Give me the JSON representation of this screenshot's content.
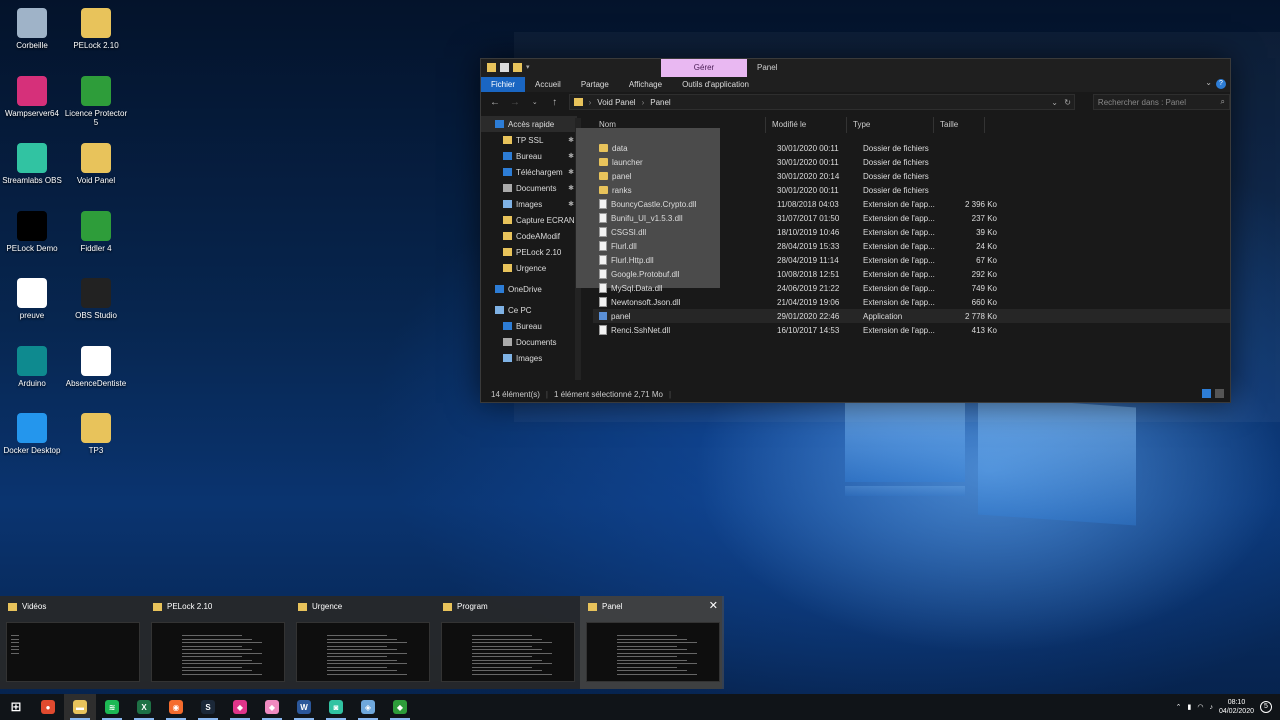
{
  "desktop_icons": [
    {
      "label": "Corbeille",
      "icon": "recycle-bin-icon",
      "color": "#9fb3c8"
    },
    {
      "label": "PELock 2.10",
      "icon": "folder-icon",
      "color": "#e8c35b"
    },
    {
      "label": "Wampserver64",
      "icon": "wamp-icon",
      "color": "#d6307a"
    },
    {
      "label": "Licence Protector 5",
      "icon": "shield-icon",
      "color": "#2e9d3a"
    },
    {
      "label": "Streamlabs OBS",
      "icon": "streamlabs-icon",
      "color": "#31c3a2"
    },
    {
      "label": "Void Panel",
      "icon": "folder-icon",
      "color": "#e8c35b"
    },
    {
      "label": "PELock Demo",
      "icon": "pe-icon",
      "color": "#000000"
    },
    {
      "label": "Fiddler 4",
      "icon": "fiddler-icon",
      "color": "#2e9d3a"
    },
    {
      "label": "preuve",
      "icon": "document-icon",
      "color": "#ffffff"
    },
    {
      "label": "OBS Studio",
      "icon": "obs-icon",
      "color": "#222222"
    },
    {
      "label": "Arduino",
      "icon": "arduino-icon",
      "color": "#0e8a8f"
    },
    {
      "label": "AbsenceDentiste",
      "icon": "document-icon",
      "color": "#ffffff"
    },
    {
      "label": "Docker Desktop",
      "icon": "docker-icon",
      "color": "#2496ed"
    },
    {
      "label": "TP3",
      "icon": "zip-icon",
      "color": "#e8c35b"
    }
  ],
  "explorer": {
    "manage_tab": "Gérer",
    "title": "Panel",
    "ribbon_tabs": [
      "Fichier",
      "Accueil",
      "Partage",
      "Affichage",
      "Outils d'application"
    ],
    "breadcrumb": [
      "Void Panel",
      "Panel"
    ],
    "search_placeholder": "Rechercher dans : Panel",
    "nav_items": [
      {
        "label": "Accès rapide",
        "icon": "star-icon",
        "pinned": false,
        "indent": 0
      },
      {
        "label": "TP SSL",
        "icon": "folder-icon",
        "pinned": true,
        "indent": 1
      },
      {
        "label": "Bureau",
        "icon": "desktop-icon",
        "pinned": true,
        "indent": 1
      },
      {
        "label": "Téléchargem",
        "icon": "download-icon",
        "pinned": true,
        "indent": 1
      },
      {
        "label": "Documents",
        "icon": "documents-icon",
        "pinned": true,
        "indent": 1
      },
      {
        "label": "Images",
        "icon": "images-icon",
        "pinned": true,
        "indent": 1
      },
      {
        "label": "Capture ECRAN",
        "icon": "folder-icon",
        "pinned": false,
        "indent": 1
      },
      {
        "label": "CodeAModif",
        "icon": "folder-icon",
        "pinned": false,
        "indent": 1
      },
      {
        "label": "PELock 2.10",
        "icon": "folder-icon",
        "pinned": false,
        "indent": 1
      },
      {
        "label": "Urgence",
        "icon": "folder-icon",
        "pinned": false,
        "indent": 1
      },
      {
        "label": "OneDrive",
        "icon": "cloud-icon",
        "pinned": false,
        "indent": 0
      },
      {
        "label": "Ce PC",
        "icon": "pc-icon",
        "pinned": false,
        "indent": 0
      },
      {
        "label": "Bureau",
        "icon": "desktop-icon",
        "pinned": false,
        "indent": 1
      },
      {
        "label": "Documents",
        "icon": "documents-icon",
        "pinned": false,
        "indent": 1
      },
      {
        "label": "Images",
        "icon": "images-icon",
        "pinned": false,
        "indent": 1
      }
    ],
    "columns": [
      "Nom",
      "Modifié le",
      "Type",
      "Taille"
    ],
    "files": [
      {
        "name": "data",
        "date": "30/01/2020 00:11",
        "type": "Dossier de fichiers",
        "size": "",
        "kind": "folder"
      },
      {
        "name": "launcher",
        "date": "30/01/2020 00:11",
        "type": "Dossier de fichiers",
        "size": "",
        "kind": "folder"
      },
      {
        "name": "panel",
        "date": "30/01/2020 20:14",
        "type": "Dossier de fichiers",
        "size": "",
        "kind": "folder"
      },
      {
        "name": "ranks",
        "date": "30/01/2020 00:11",
        "type": "Dossier de fichiers",
        "size": "",
        "kind": "folder"
      },
      {
        "name": "BouncyCastle.Crypto.dll",
        "date": "11/08/2018 04:03",
        "type": "Extension de l'app...",
        "size": "2 396 Ko",
        "kind": "dll"
      },
      {
        "name": "Bunifu_UI_v1.5.3.dll",
        "date": "31/07/2017 01:50",
        "type": "Extension de l'app...",
        "size": "237 Ko",
        "kind": "dll"
      },
      {
        "name": "CSGSI.dll",
        "date": "18/10/2019 10:46",
        "type": "Extension de l'app...",
        "size": "39 Ko",
        "kind": "dll"
      },
      {
        "name": "Flurl.dll",
        "date": "28/04/2019 15:33",
        "type": "Extension de l'app...",
        "size": "24 Ko",
        "kind": "dll"
      },
      {
        "name": "Flurl.Http.dll",
        "date": "28/04/2019 11:14",
        "type": "Extension de l'app...",
        "size": "67 Ko",
        "kind": "dll"
      },
      {
        "name": "Google.Protobuf.dll",
        "date": "10/08/2018 12:51",
        "type": "Extension de l'app...",
        "size": "292 Ko",
        "kind": "dll"
      },
      {
        "name": "MySql.Data.dll",
        "date": "24/06/2019 21:22",
        "type": "Extension de l'app...",
        "size": "749 Ko",
        "kind": "dll"
      },
      {
        "name": "Newtonsoft.Json.dll",
        "date": "21/04/2019 19:06",
        "type": "Extension de l'app...",
        "size": "660 Ko",
        "kind": "dll"
      },
      {
        "name": "panel",
        "date": "29/01/2020 22:46",
        "type": "Application",
        "size": "2 778 Ko",
        "kind": "app",
        "selected": true
      },
      {
        "name": "Renci.SshNet.dll",
        "date": "16/10/2017 14:53",
        "type": "Extension de l'app...",
        "size": "413 Ko",
        "kind": "dll"
      }
    ],
    "status_count": "14 élément(s)",
    "status_selection": "1 élément sélectionné  2,71 Mo"
  },
  "task_thumbs": [
    {
      "title": "Vidéos"
    },
    {
      "title": "PELock 2.10"
    },
    {
      "title": "Urgence"
    },
    {
      "title": "Program"
    },
    {
      "title": "Panel",
      "hover": true
    }
  ],
  "taskbar": {
    "apps": [
      {
        "name": "start-button",
        "glyph": "⊞",
        "color": "#101418"
      },
      {
        "name": "chrome-icon",
        "glyph": "●",
        "color": "#e04a2f"
      },
      {
        "name": "file-explorer-icon",
        "glyph": "▬",
        "color": "#e8c35b"
      },
      {
        "name": "spotify-icon",
        "glyph": "≋",
        "color": "#1db954"
      },
      {
        "name": "excel-icon",
        "glyph": "X",
        "color": "#1e7145"
      },
      {
        "name": "origin-icon",
        "glyph": "◉",
        "color": "#f56c2d"
      },
      {
        "name": "steam-icon",
        "glyph": "S",
        "color": "#1b2838"
      },
      {
        "name": "app-pink-icon",
        "glyph": "◆",
        "color": "#e0358a"
      },
      {
        "name": "app-pink2-icon",
        "glyph": "◆",
        "color": "#f08ac0"
      },
      {
        "name": "word-icon",
        "glyph": "W",
        "color": "#2b579a"
      },
      {
        "name": "streamlabs-icon",
        "glyph": "◙",
        "color": "#31c3a2"
      },
      {
        "name": "app-blue-icon",
        "glyph": "◈",
        "color": "#6fa8dc"
      },
      {
        "name": "fiddler-icon",
        "glyph": "◆",
        "color": "#2e9d3a"
      }
    ],
    "time": "08:10",
    "date": "04/02/2020",
    "notif_count": "5"
  }
}
